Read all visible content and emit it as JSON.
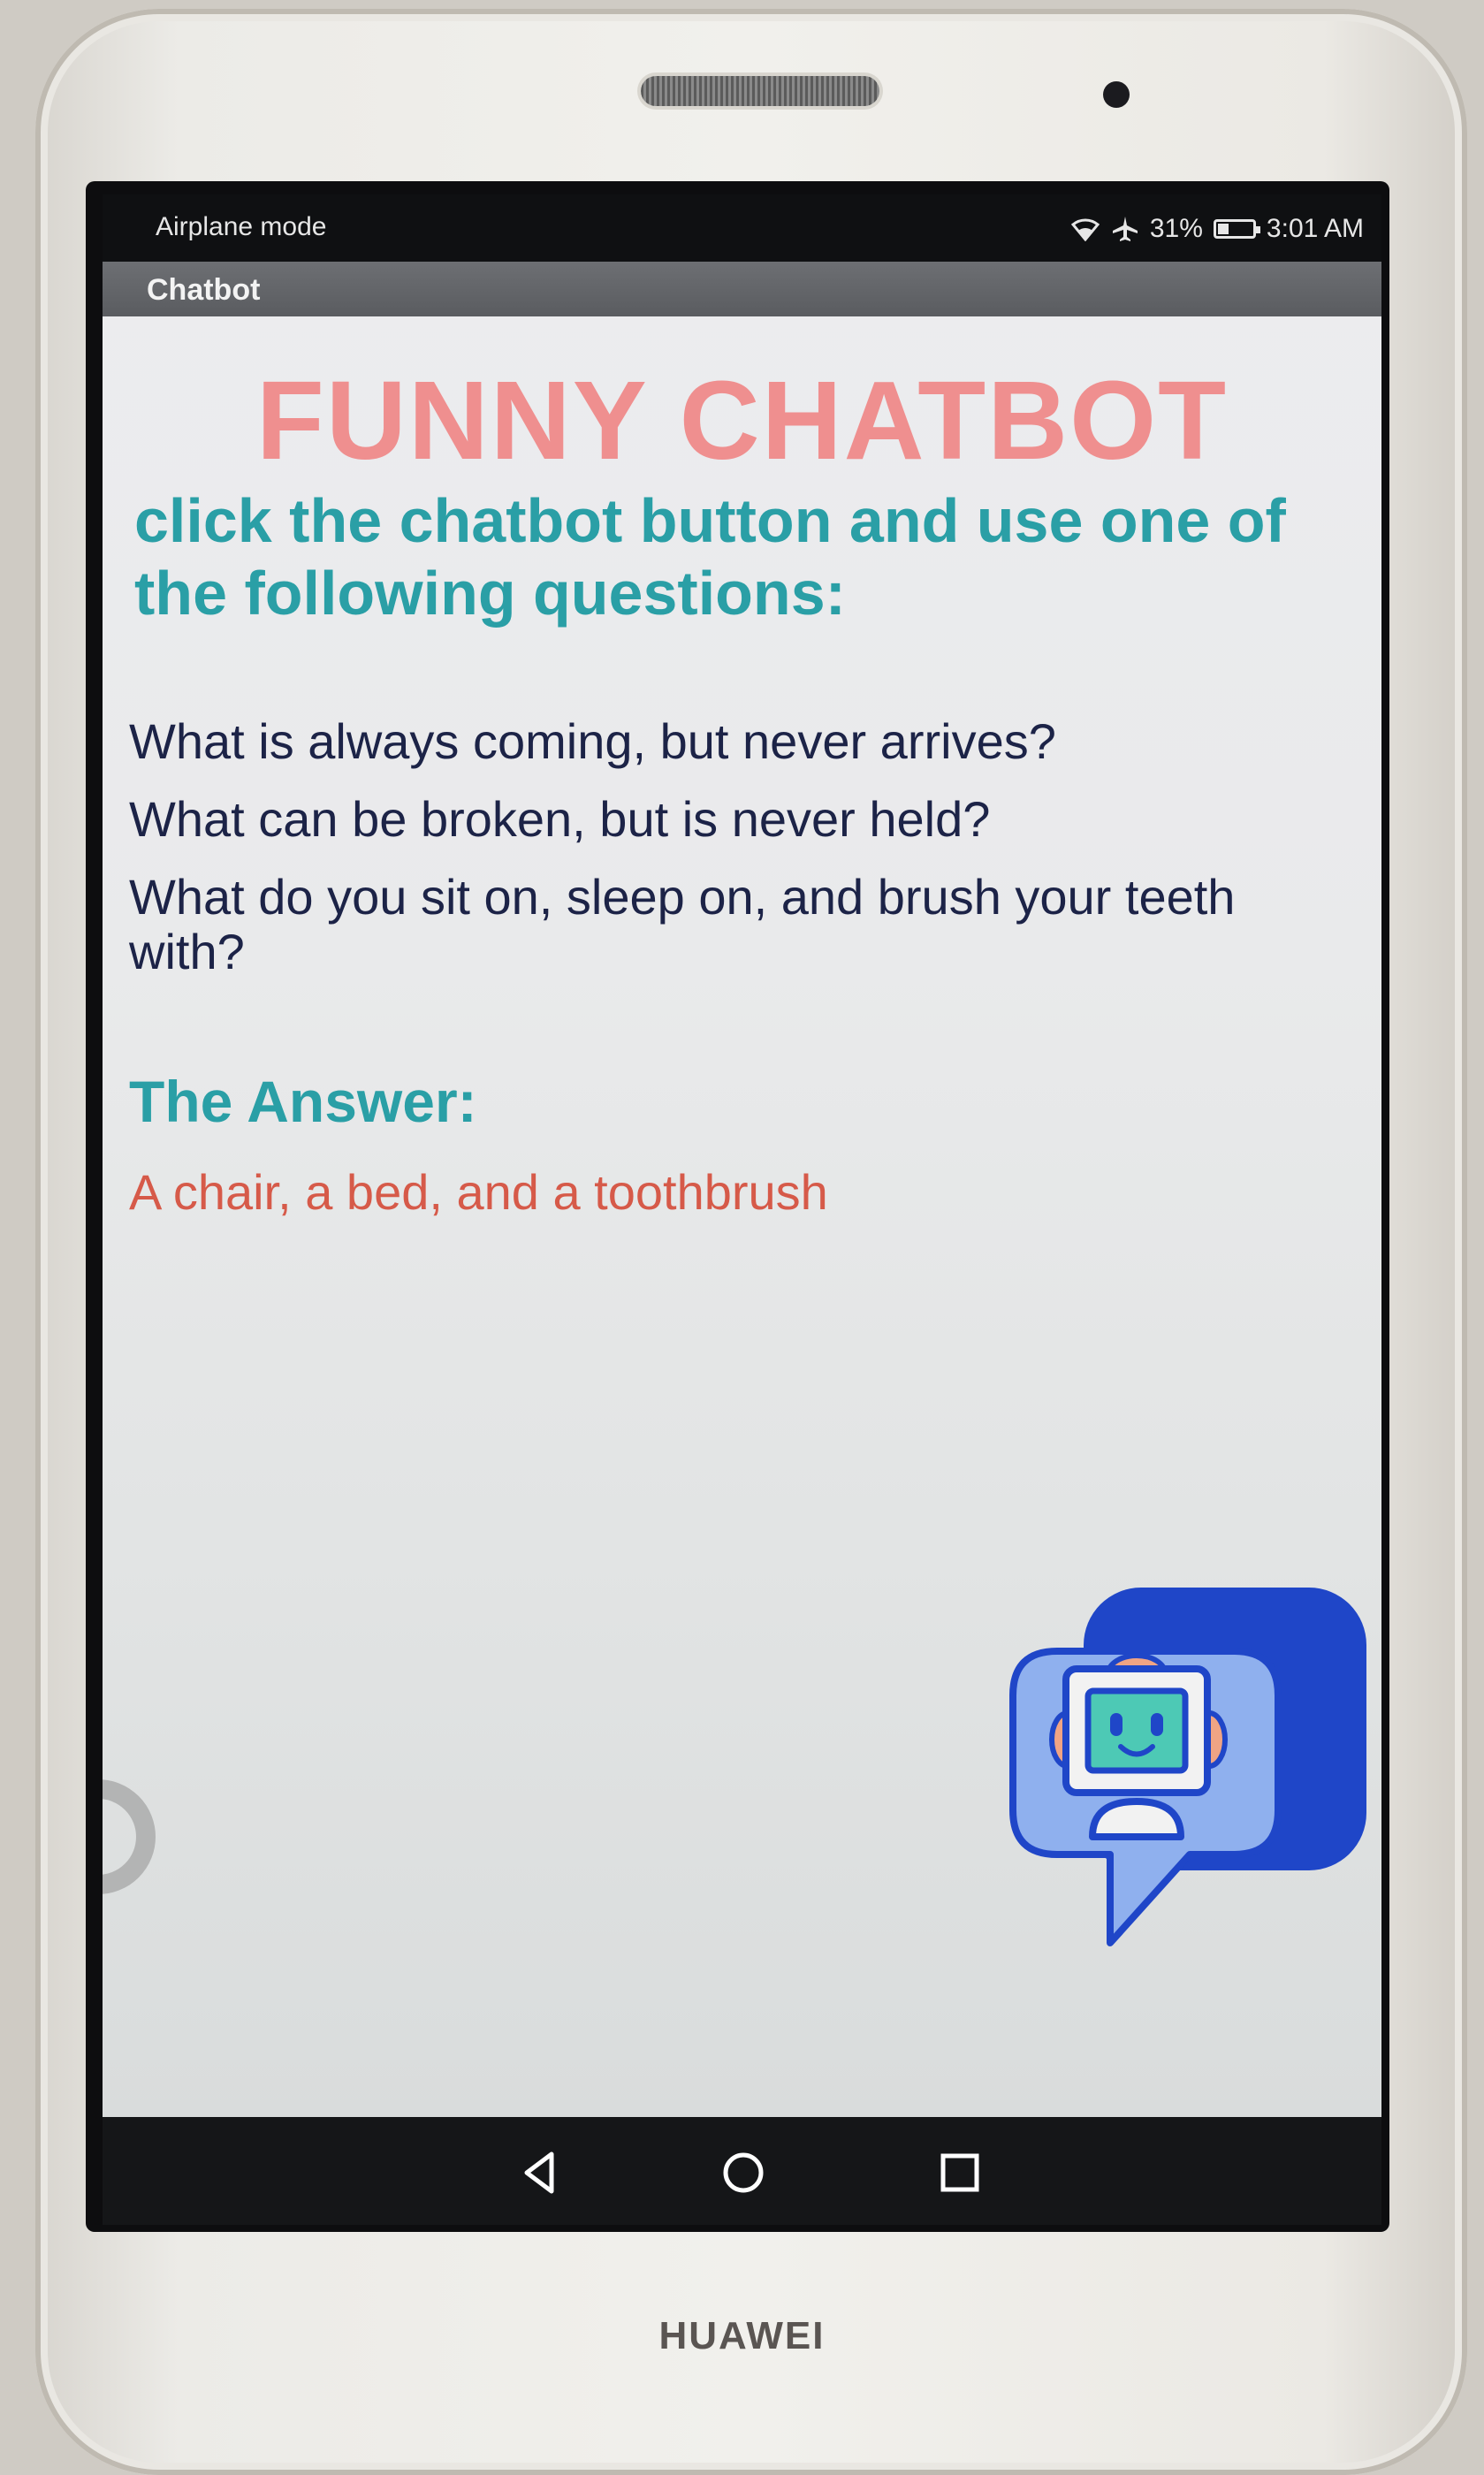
{
  "device": {
    "brand": "HUAWEI"
  },
  "status_bar": {
    "left_text": "Airplane mode",
    "battery_percent": "31%",
    "battery_level": 0.31,
    "time": "3:01 AM",
    "icons": [
      "wifi-icon",
      "airplane-icon",
      "battery-icon"
    ]
  },
  "app_bar": {
    "title": "Chatbot"
  },
  "main": {
    "title": "FUNNY CHATBOT",
    "instructions": "click the chatbot button and use one of the following questions:",
    "questions": [
      "What is always coming, but never arrives?",
      "What can be broken, but is never held?",
      "What do you sit on, sleep on, and brush your teeth with?"
    ],
    "answer_heading": "The Answer:",
    "answer_text": "A chair, a bed, and a toothbrush"
  },
  "nav_bar": {
    "buttons": [
      "back-icon",
      "home-icon",
      "recents-icon"
    ]
  },
  "colors": {
    "title": "#ef8f8f",
    "heading": "#2a9fa6",
    "question": "#1c2347",
    "answer": "#d65a49",
    "chatbot_blue": "#1f46c8",
    "chatbot_light": "#8fb0ee"
  }
}
